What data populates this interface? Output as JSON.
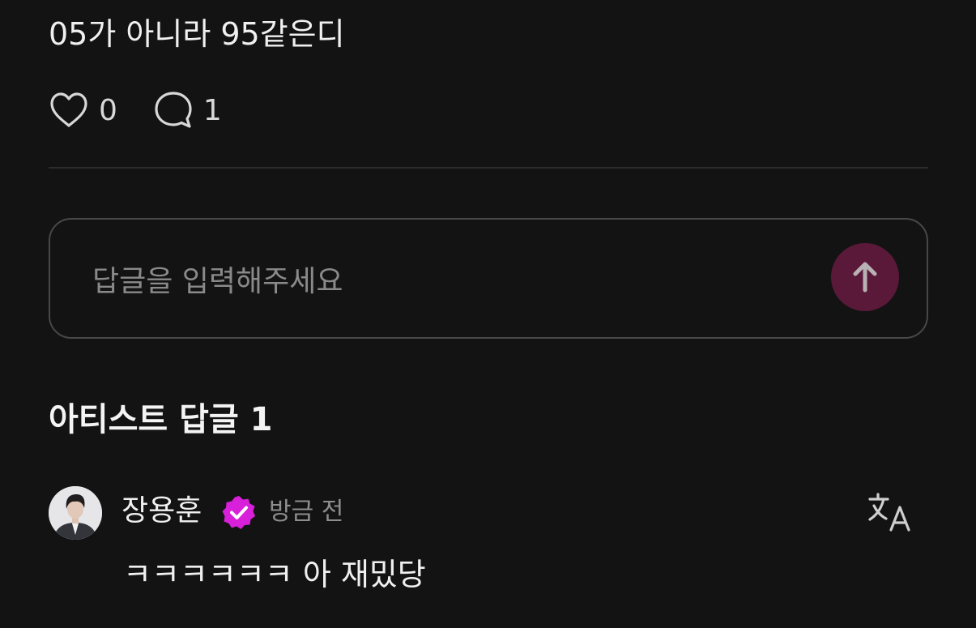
{
  "post": {
    "text": "05가 아니라 95같은디",
    "like_count": "0",
    "comment_count": "1"
  },
  "reply_input": {
    "placeholder": "답글을 입력해주세요",
    "value": ""
  },
  "artist_replies": {
    "section_title": "아티스트 답글 1",
    "items": [
      {
        "author": "장용훈",
        "verified": true,
        "timestamp": "방금 전",
        "text": "ㅋㅋㅋㅋㅋㅋ 아 재밌당"
      }
    ]
  },
  "icons": {
    "like": "heart-outline-icon",
    "comment": "chat-bubble-icon",
    "send": "arrow-up-icon",
    "verified": "verified-badge-icon",
    "translate": "translate-icon"
  },
  "colors": {
    "background": "#131313",
    "send_button": "#5a1939",
    "send_arrow": "#b9b2b5",
    "verified": "#d81fd9",
    "divider": "#2c2c2c",
    "input_border": "#484848"
  }
}
